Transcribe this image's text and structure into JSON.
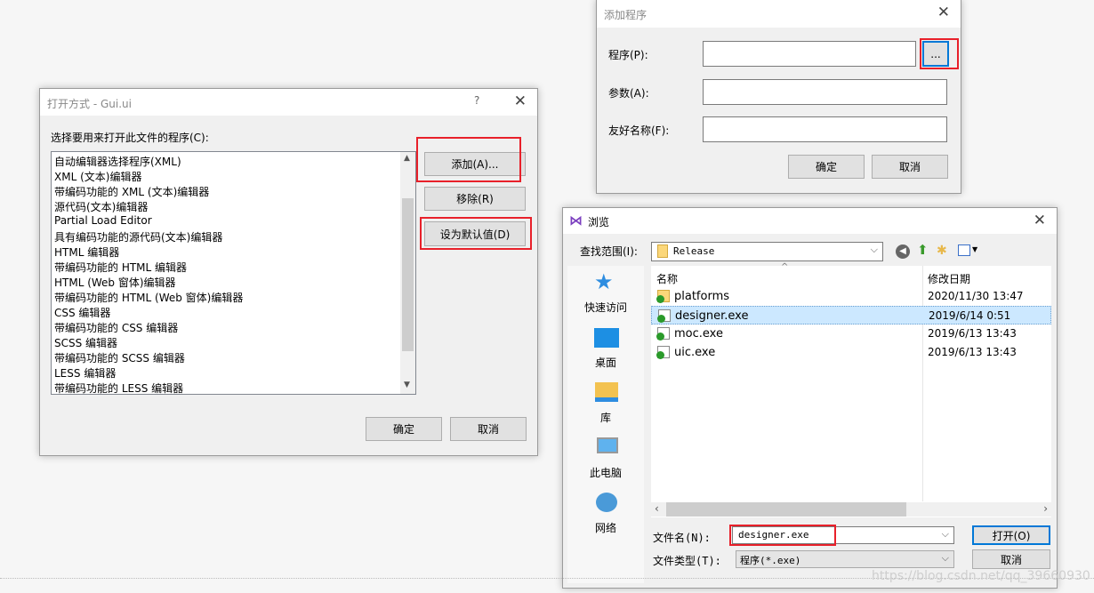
{
  "open_with": {
    "title": "打开方式 - Gui.ui",
    "help": "?",
    "prompt": "选择要用来打开此文件的程序(C):",
    "programs": [
      "自动编辑器选择程序(XML)",
      "XML (文本)编辑器",
      "带编码功能的 XML (文本)编辑器",
      "源代码(文本)编辑器",
      "Partial Load Editor",
      "具有编码功能的源代码(文本)编辑器",
      "HTML 编辑器",
      "带编码功能的 HTML 编辑器",
      "HTML (Web 窗体)编辑器",
      "带编码功能的 HTML (Web 窗体)编辑器",
      "CSS 编辑器",
      "带编码功能的 CSS 编辑器",
      "SCSS 编辑器",
      "带编码功能的 SCSS 编辑器",
      "LESS 编辑器",
      "带编码功能的 LESS 编辑器"
    ],
    "add": "添加(A)...",
    "remove": "移除(R)",
    "set_default": "设为默认值(D)",
    "ok": "确定",
    "cancel": "取消"
  },
  "add_program": {
    "title": "添加程序",
    "program_label": "程序(P):",
    "program_value": "",
    "browse": "...",
    "args_label": "参数(A):",
    "args_value": "",
    "friendly_label": "友好名称(F):",
    "friendly_value": "",
    "ok": "确定",
    "cancel": "取消"
  },
  "browse": {
    "title": "浏览",
    "look_in_label": "查找范围(I):",
    "look_in": "Release",
    "sidebar": [
      "快速访问",
      "桌面",
      "库",
      "此电脑",
      "网络"
    ],
    "columns": [
      "名称",
      "修改日期"
    ],
    "files": [
      {
        "name": "platforms",
        "date": "2020/11/30 13:47",
        "type": "folder"
      },
      {
        "name": "designer.exe",
        "date": "2019/6/14 0:51",
        "type": "exe",
        "selected": true
      },
      {
        "name": "moc.exe",
        "date": "2019/6/13 13:43",
        "type": "exe"
      },
      {
        "name": "uic.exe",
        "date": "2019/6/13 13:43",
        "type": "exe"
      }
    ],
    "filename_label": "文件名(N):",
    "filename": "designer.exe",
    "filetype_label": "文件类型(T):",
    "filetype": "程序(*.exe)",
    "open": "打开(O)",
    "cancel": "取消"
  },
  "watermark": "https://blog.csdn.net/qq_39660930",
  "colors": {
    "highlight": "#e8202a",
    "selection": "#cce8ff",
    "accent": "#0078d7"
  }
}
